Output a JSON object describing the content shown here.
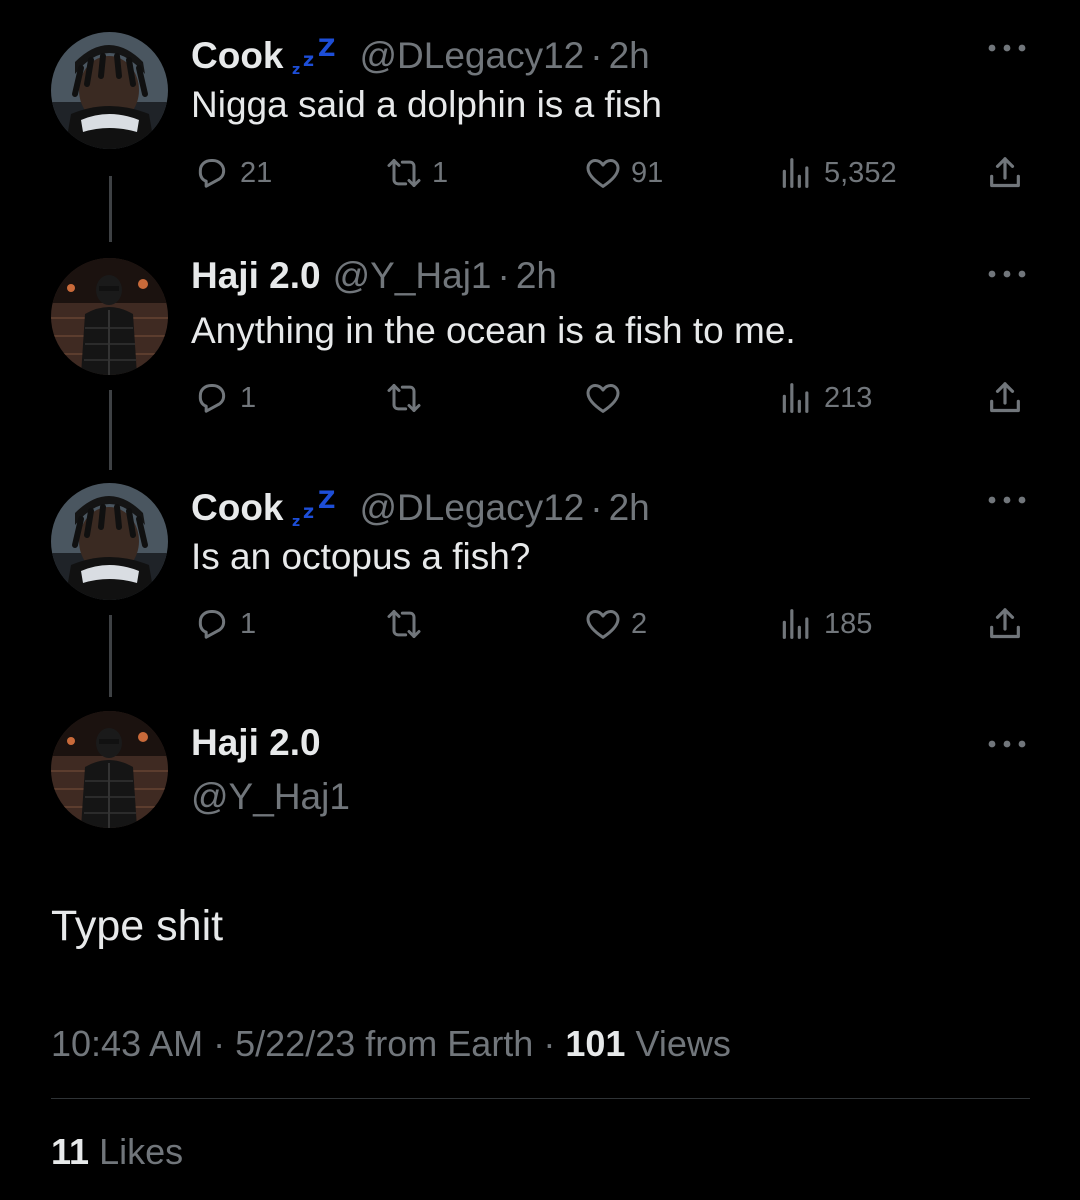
{
  "colors": {
    "background": "#000000",
    "primary_text": "#e7e9ea",
    "secondary_text": "#71767b",
    "thread_line": "#3e4144",
    "zzz_blue": "#1d4ed8"
  },
  "replies": [
    {
      "display_name": "Cook",
      "name_emoji": "zzz-icon",
      "handle": "@DLegacy12",
      "separator": "·",
      "time": "2h",
      "text": "Nigga said a dolphin is a fish",
      "stats": {
        "replies": "21",
        "retweets": "1",
        "likes": "91",
        "views": "5,352"
      }
    },
    {
      "display_name": "Haji 2.0",
      "handle": "@Y_Haj1",
      "separator": "·",
      "time": "2h",
      "text": "Anything in the ocean is a fish to me.",
      "stats": {
        "replies": "1",
        "retweets": "",
        "likes": "",
        "views": "213"
      }
    },
    {
      "display_name": "Cook",
      "name_emoji": "zzz-icon",
      "handle": "@DLegacy12",
      "separator": "·",
      "time": "2h",
      "text": "Is an octopus a fish?",
      "stats": {
        "replies": "1",
        "retweets": "",
        "likes": "2",
        "views": "185"
      }
    }
  ],
  "main_tweet": {
    "display_name": "Haji 2.0",
    "handle": "@Y_Haj1",
    "text": "Type shit",
    "time": "10:43 AM",
    "date": "5/22/23",
    "source": "from Earth",
    "separator": "·",
    "views_count": "101",
    "views_label": "Views",
    "likes_count": "11",
    "likes_label": "Likes"
  }
}
